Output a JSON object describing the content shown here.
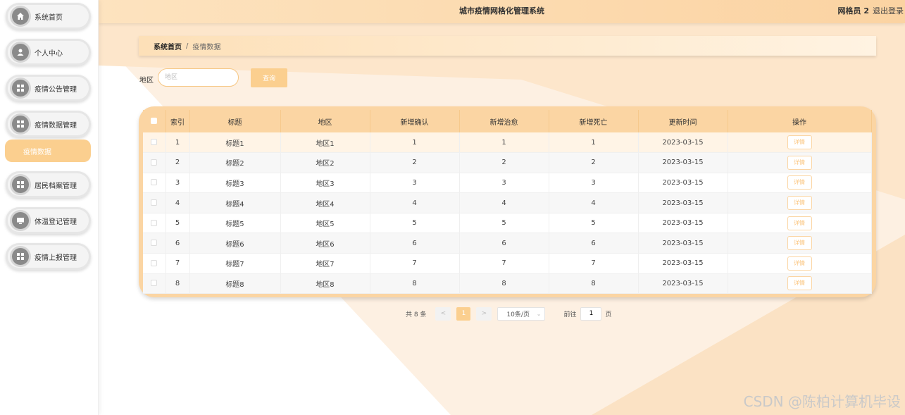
{
  "header": {
    "title": "城市疫情网格化管理系统",
    "user": "网格员 2",
    "logout": "退出登录"
  },
  "sidebar": {
    "items": [
      {
        "label": "系统首页",
        "icon": "home-icon"
      },
      {
        "label": "个人中心",
        "icon": "user-icon"
      },
      {
        "label": "疫情公告管理",
        "icon": "grid-icon"
      },
      {
        "label": "疫情数据管理",
        "icon": "grid-icon"
      },
      {
        "label": "居民档案管理",
        "icon": "grid-icon"
      },
      {
        "label": "体温登记管理",
        "icon": "monitor-icon"
      },
      {
        "label": "疫情上报管理",
        "icon": "grid-icon"
      }
    ],
    "active_sub": "疫情数据"
  },
  "breadcrumb": {
    "home": "系统首页",
    "separator": "/",
    "current": "疫情数据"
  },
  "search": {
    "label": "地区",
    "placeholder": "地区",
    "button": "查询"
  },
  "table": {
    "columns": [
      "索引",
      "标题",
      "地区",
      "新增确认",
      "新增治愈",
      "新增死亡",
      "更新时间",
      "操作"
    ],
    "action_label": "详情",
    "rows": [
      [
        "1",
        "标题1",
        "地区1",
        "1",
        "1",
        "1",
        "2023-03-15"
      ],
      [
        "2",
        "标题2",
        "地区2",
        "2",
        "2",
        "2",
        "2023-03-15"
      ],
      [
        "3",
        "标题3",
        "地区3",
        "3",
        "3",
        "3",
        "2023-03-15"
      ],
      [
        "4",
        "标题4",
        "地区4",
        "4",
        "4",
        "4",
        "2023-03-15"
      ],
      [
        "5",
        "标题5",
        "地区5",
        "5",
        "5",
        "5",
        "2023-03-15"
      ],
      [
        "6",
        "标题6",
        "地区6",
        "6",
        "6",
        "6",
        "2023-03-15"
      ],
      [
        "7",
        "标题7",
        "地区7",
        "7",
        "7",
        "7",
        "2023-03-15"
      ],
      [
        "8",
        "标题8",
        "地区8",
        "8",
        "8",
        "8",
        "2023-03-15"
      ]
    ]
  },
  "pagination": {
    "total": "共 8 条",
    "prev": "<",
    "current": "1",
    "next": ">",
    "page_size": "10条/页",
    "goto_label": "前往",
    "goto_value": "1",
    "page_suffix": "页"
  },
  "watermark": "CSDN @陈柏计算机毕设",
  "colors": {
    "accent": "#fbcf8f",
    "header_bg": "#fde3bf",
    "table_header": "#fbd5a3"
  }
}
